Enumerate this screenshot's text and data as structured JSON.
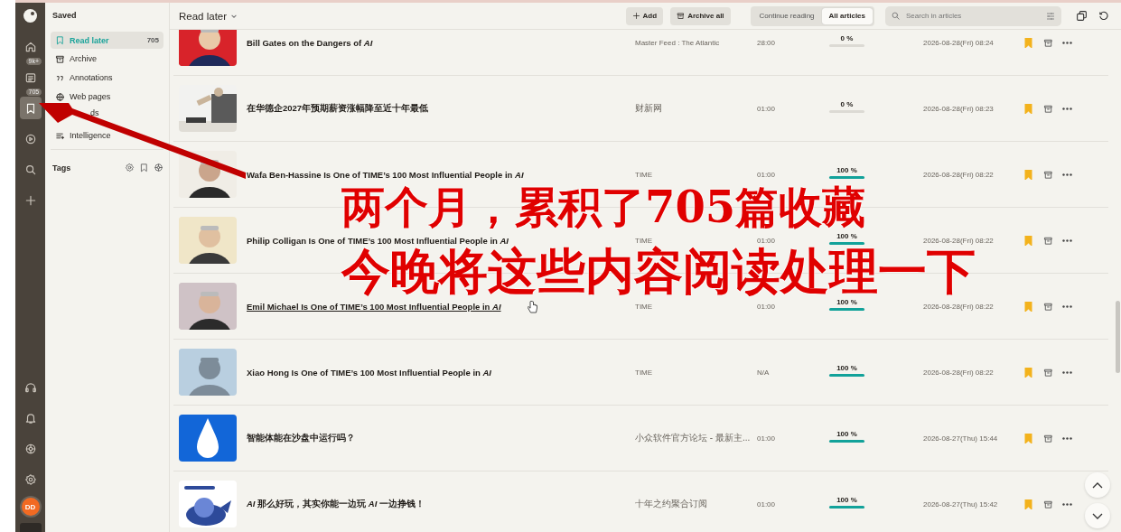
{
  "rail": {
    "items": [
      {
        "selected": false
      },
      {
        "selected": false,
        "badge": "9k+"
      },
      {
        "selected": true,
        "badge": "705"
      },
      {
        "selected": false
      },
      {
        "selected": false
      },
      {
        "selected": false
      }
    ],
    "avatar": "DD"
  },
  "sidebar": {
    "title": "Saved",
    "items": [
      {
        "label": "Read later",
        "count": "705",
        "selected": true
      },
      {
        "label": "Archive",
        "selected": false
      },
      {
        "label": "Annotations",
        "selected": false
      },
      {
        "label": "Web pages",
        "selected": false
      },
      {
        "label": "ds",
        "selected": false
      },
      {
        "label": "Intelligence",
        "selected": false
      }
    ],
    "tags_title": "Tags"
  },
  "header": {
    "title": "Read later",
    "buttons": [
      "Add",
      "Archive all"
    ],
    "tabs": [
      {
        "label": "Continue reading",
        "selected": false
      },
      {
        "label": "All articles",
        "selected": true
      }
    ],
    "search": {
      "placeholder": "Search in articles"
    }
  },
  "articles": [
    {
      "title": "Bill Gates on the Dangers of *AI*",
      "source": "Master Feed : The Atlantic",
      "time": "28:00",
      "progress": "0 %",
      "level": 0,
      "date": "2026-08-28(Fri) 08:24",
      "bookmarked": true,
      "hovered": false
    },
    {
      "title": "在华德企2027年预期薪资涨幅降至近十年最低",
      "source": "财新网",
      "time": "01:00",
      "progress": "0 %",
      "level": 0,
      "date": "2026-08-28(Fri) 08:23",
      "bookmarked": true,
      "hovered": false
    },
    {
      "title": "Wafa Ben-Hassine Is One of TIME’s 100 Most Influential People in *AI*",
      "source": "TIME",
      "time": "01:00",
      "progress": "100 %",
      "level": 1,
      "date": "2026-08-28(Fri) 08:22",
      "bookmarked": true,
      "hovered": false
    },
    {
      "title": "Philip Colligan Is One of TIME’s 100 Most Influential People in *AI*",
      "source": "TIME",
      "time": "01:00",
      "progress": "100 %",
      "level": 1,
      "date": "2026-08-28(Fri) 08:22",
      "bookmarked": true,
      "hovered": false
    },
    {
      "title": "Emil Michael Is One of TIME’s 100 Most Influential People in *AI*",
      "source": "TIME",
      "time": "01:00",
      "progress": "100 %",
      "level": 1,
      "date": "2026-08-28(Fri) 08:22",
      "bookmarked": true,
      "hovered": true
    },
    {
      "title": "Xiao Hong Is One of TIME’s 100 Most Influential People in *AI*",
      "source": "TIME",
      "time": "N/A",
      "progress": "100 %",
      "level": 1,
      "date": "2026-08-28(Fri) 08:22",
      "bookmarked": true,
      "hovered": false
    },
    {
      "title": "智能体能在沙盘中运行吗？",
      "source": "小众软件官方论坛 - 最新主...",
      "time": "01:00",
      "progress": "100 %",
      "level": 1,
      "date": "2026-08-27(Thu) 15:44",
      "bookmarked": true,
      "hovered": false
    },
    {
      "title": "*AI* 那么好玩，其实你能一边玩 *AI* 一边挣钱！",
      "source": "十年之约聚合订阅",
      "time": "01:00",
      "progress": "100 %",
      "level": 1,
      "date": "2026-08-27(Thu) 15:42",
      "bookmarked": true,
      "hovered": false
    }
  ],
  "annotation": {
    "lines": [
      "两个月，累积了705篇收藏",
      "今晚将这些内容阅读处理一下"
    ]
  }
}
